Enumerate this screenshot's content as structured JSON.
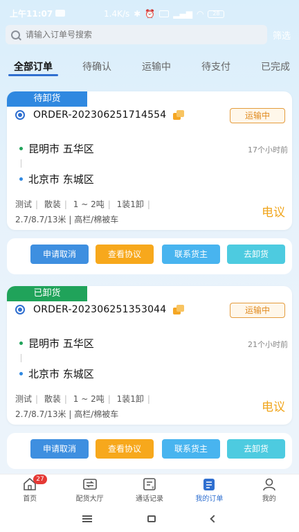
{
  "status_bar": {
    "time": "上午11:07",
    "speed": "1.4K/s",
    "battery": "28"
  },
  "search": {
    "placeholder": "请输入订单号搜索",
    "filter_label": "筛选"
  },
  "tabs": [
    {
      "label": "全部订单",
      "active": true
    },
    {
      "label": "待确认",
      "active": false
    },
    {
      "label": "运输中",
      "active": false
    },
    {
      "label": "待支付",
      "active": false
    },
    {
      "label": "已完成",
      "active": false
    }
  ],
  "orders": [
    {
      "status_tag": "待卸货",
      "status_color": "#2f88e0",
      "order_no": "ORDER-202306251714554",
      "badge": "运输中",
      "from": "昆明市 五华区",
      "to": "北京市 东城区",
      "time_ago": "17个小时前",
      "tags": [
        "测试",
        "散装",
        "1 ~ 2吨",
        "1装1卸"
      ],
      "spec": "2.7/8.7/13米 | 高栏/棉被车",
      "price": "电议",
      "actions": {
        "cancel": "申请取消",
        "protocol": "查看协议",
        "contact": "联系货主",
        "unload": "去卸货"
      }
    },
    {
      "status_tag": "已卸货",
      "status_color": "#20a35a",
      "order_no": "ORDER-202306251353044",
      "badge": "运输中",
      "from": "昆明市 五华区",
      "to": "北京市 东城区",
      "time_ago": "21个小时前",
      "tags": [
        "测试",
        "散装",
        "1 ~ 2吨",
        "1装1卸"
      ],
      "spec": "2.7/8.7/13米 | 高栏/棉被车",
      "price": "电议",
      "actions": {
        "cancel": "申请取消",
        "protocol": "查看协议",
        "contact": "联系货主",
        "unload": "去卸货"
      }
    }
  ],
  "bottom_nav": [
    {
      "label": "首页",
      "icon": "home-icon",
      "badge": "27"
    },
    {
      "label": "配货大厅",
      "icon": "exchange-icon"
    },
    {
      "label": "通话记录",
      "icon": "call-record-icon"
    },
    {
      "label": "我的订单",
      "icon": "orders-icon",
      "active": true
    },
    {
      "label": "我的",
      "icon": "profile-icon"
    }
  ],
  "colors": {
    "accent": "#2f6fd0",
    "price": "#f0a51c",
    "badge_border": "#e49b3c"
  }
}
